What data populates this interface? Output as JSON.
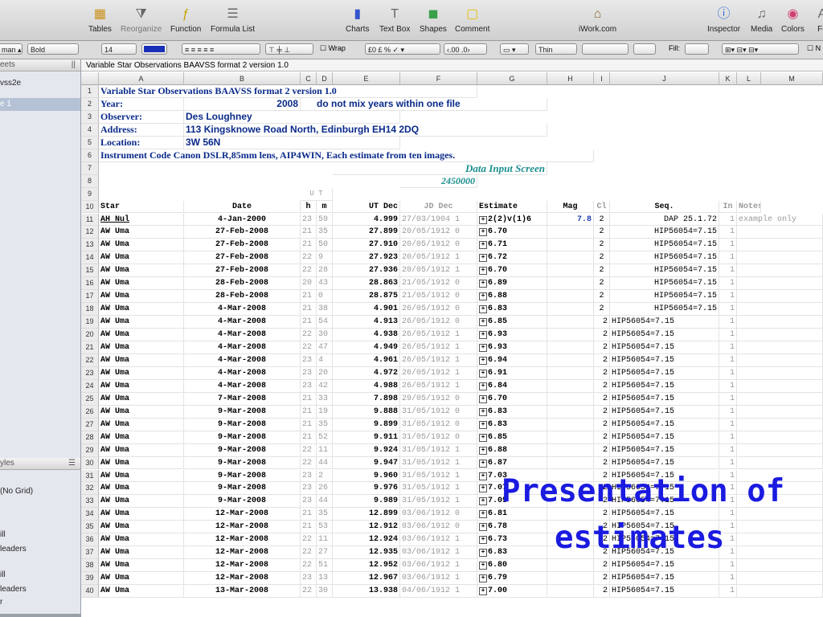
{
  "toolbar": {
    "items": [
      {
        "label": "Tables",
        "icon": "tables-icon"
      },
      {
        "label": "Reorganize",
        "icon": "reorganize-icon"
      },
      {
        "label": "Function",
        "icon": "function-icon"
      },
      {
        "label": "Formula List",
        "icon": "formula-list-icon"
      },
      {
        "label": "Charts",
        "icon": "charts-icon"
      },
      {
        "label": "Text Box",
        "icon": "text-box-icon"
      },
      {
        "label": "Shapes",
        "icon": "shapes-icon"
      },
      {
        "label": "Comment",
        "icon": "comment-icon"
      },
      {
        "label": "iWork.com",
        "icon": "iwork-icon"
      },
      {
        "label": "Inspector",
        "icon": "inspector-icon"
      },
      {
        "label": "Media",
        "icon": "media-icon"
      },
      {
        "label": "Colors",
        "icon": "colors-icon"
      },
      {
        "label": "Fo",
        "icon": "fonts-icon"
      }
    ]
  },
  "format_bar": {
    "font_name": "man",
    "font_style": "Bold",
    "font_size": "14",
    "text_color": "#1a2fb8",
    "wrap_label": "Wrap",
    "decimals": ".00",
    "line_style": "Thin",
    "fill_label": "Fill:",
    "grid_label": "N"
  },
  "sidebar": {
    "sheets_header": "eets",
    "sheet_name": "vss2e",
    "table_name": "e 1",
    "styles_header": "yles",
    "styles": [
      "(No Grid)",
      "ill",
      "leaders",
      "ill",
      "leaders",
      "r"
    ]
  },
  "table": {
    "title": "Variable Star Observations BAAVSS format 2 version 1.0",
    "columns": [
      "A",
      "B",
      "C",
      "D",
      "E",
      "F",
      "G",
      "H",
      "I",
      "J",
      "K",
      "L",
      "M"
    ],
    "header_block": {
      "r1": "Variable Star Observations BAAVSS format 2 version 1.0",
      "r2_label": "Year:",
      "r2_value": "2008",
      "r2_note": "do not mix years within one file",
      "r3_label": "Observer:",
      "r3_value": "Des Loughney",
      "r4_label": "Address:",
      "r4_value": "113 Kingsknowe Road North, Edinburgh EH14 2DQ",
      "r5_label": "Location:",
      "r5_value": "3W 56N",
      "r6": "Instrument Code Canon DSLR,85mm lens, AIP4WIN, Each estimate from ten images.",
      "r7": "Data Input Screen",
      "r8": "2450000",
      "r9_ut": "U T"
    },
    "headers": [
      "Star",
      "Date",
      "h",
      "m",
      "UT Dec",
      "JD Dec",
      "Estimate",
      "Mag",
      "Cl",
      "Seq.",
      "In",
      "Notes"
    ],
    "rows": [
      [
        "11",
        "AH Nul",
        "4-Jan-2000",
        "23",
        "59",
        "4.999",
        "27/03/1904 1",
        "2(2)v(1)6",
        "7.8",
        "2",
        "DAP 25.1.72",
        "1",
        "example only"
      ],
      [
        "12",
        "AW Uma",
        "27-Feb-2008",
        "21",
        "35",
        "27.899",
        "20/05/1912 0",
        "6.70",
        "",
        "2",
        "HIP56054=7.15",
        "1",
        ""
      ],
      [
        "13",
        "AW Uma",
        "27-Feb-2008",
        "21",
        "50",
        "27.910",
        "20/05/1912 0",
        "6.71",
        "",
        "2",
        "HIP56054=7.15",
        "1",
        ""
      ],
      [
        "14",
        "AW Uma",
        "27-Feb-2008",
        "22",
        "9",
        "27.923",
        "20/05/1912 1",
        "6.72",
        "",
        "2",
        "HIP56054=7.15",
        "1",
        ""
      ],
      [
        "15",
        "AW Uma",
        "27-Feb-2008",
        "22",
        "28",
        "27.936",
        "20/05/1912 1",
        "6.70",
        "",
        "2",
        "HIP56054=7.15",
        "1",
        ""
      ],
      [
        "16",
        "AW Uma",
        "28-Feb-2008",
        "20",
        "43",
        "28.863",
        "21/05/1912 0",
        "6.89",
        "",
        "2",
        "HIP56054=7.15",
        "1",
        ""
      ],
      [
        "17",
        "AW Uma",
        "28-Feb-2008",
        "21",
        "0",
        "28.875",
        "21/05/1912 0",
        "6.88",
        "",
        "2",
        "HIP56054=7.15",
        "1",
        ""
      ],
      [
        "18",
        "AW Uma",
        "4-Mar-2008",
        "21",
        "38",
        "4.901",
        "26/05/1912 0",
        "6.83",
        "",
        "2",
        "HIP56054=7.15",
        "1",
        ""
      ],
      [
        "19",
        "AW Uma",
        "4-Mar-2008",
        "21",
        "54",
        "4.913",
        "26/05/1912 0",
        "6.85",
        "",
        "2",
        "HIP56054=7.15",
        "1",
        ""
      ],
      [
        "20",
        "AW Uma",
        "4-Mar-2008",
        "22",
        "30",
        "4.938",
        "26/05/1912 1",
        "6.93",
        "",
        "2",
        "HIP56054=7.15",
        "1",
        ""
      ],
      [
        "21",
        "AW Uma",
        "4-Mar-2008",
        "22",
        "47",
        "4.949",
        "26/05/1912 1",
        "6.93",
        "",
        "2",
        "HIP56054=7.15",
        "1",
        ""
      ],
      [
        "22",
        "AW Uma",
        "4-Mar-2008",
        "23",
        "4",
        "4.961",
        "26/05/1912 1",
        "6.94",
        "",
        "2",
        "HIP56054=7.15",
        "1",
        ""
      ],
      [
        "23",
        "AW Uma",
        "4-Mar-2008",
        "23",
        "20",
        "4.972",
        "26/05/1912 1",
        "6.91",
        "",
        "2",
        "HIP56054=7.15",
        "1",
        ""
      ],
      [
        "24",
        "AW Uma",
        "4-Mar-2008",
        "23",
        "42",
        "4.988",
        "26/05/1912 1",
        "6.84",
        "",
        "2",
        "HIP56054=7.15",
        "1",
        ""
      ],
      [
        "25",
        "AW Uma",
        "7-Mar-2008",
        "21",
        "33",
        "7.898",
        "29/05/1912 0",
        "6.70",
        "",
        "2",
        "HIP56054=7.15",
        "1",
        ""
      ],
      [
        "26",
        "AW Uma",
        "9-Mar-2008",
        "21",
        "19",
        "9.888",
        "31/05/1912 0",
        "6.83",
        "",
        "2",
        "HIP56054=7.15",
        "1",
        ""
      ],
      [
        "27",
        "AW Uma",
        "9-Mar-2008",
        "21",
        "35",
        "9.899",
        "31/05/1912 0",
        "6.83",
        "",
        "2",
        "HIP56054=7.15",
        "1",
        ""
      ],
      [
        "28",
        "AW Uma",
        "9-Mar-2008",
        "21",
        "52",
        "9.911",
        "31/05/1912 0",
        "6.85",
        "",
        "2",
        "HIP56054=7.15",
        "1",
        ""
      ],
      [
        "29",
        "AW Uma",
        "9-Mar-2008",
        "22",
        "11",
        "9.924",
        "31/05/1912 1",
        "6.88",
        "",
        "2",
        "HIP56054=7.15",
        "1",
        ""
      ],
      [
        "30",
        "AW Uma",
        "9-Mar-2008",
        "22",
        "44",
        "9.947",
        "31/05/1912 1",
        "6.87",
        "",
        "2",
        "HIP56054=7.15",
        "1",
        ""
      ],
      [
        "31",
        "AW Uma",
        "9-Mar-2008",
        "23",
        "2",
        "9.960",
        "31/05/1912 1",
        "7.03",
        "",
        "2",
        "HIP56054=7.15",
        "1",
        ""
      ],
      [
        "32",
        "AW Uma",
        "9-Mar-2008",
        "23",
        "26",
        "9.976",
        "31/05/1912 1",
        "7.07",
        "",
        "2",
        "HIP56054=7.15",
        "1",
        ""
      ],
      [
        "33",
        "AW Uma",
        "9-Mar-2008",
        "23",
        "44",
        "9.989",
        "31/05/1912 1",
        "7.05",
        "",
        "2",
        "HIP56054=7.15",
        "1",
        ""
      ],
      [
        "34",
        "AW Uma",
        "12-Mar-2008",
        "21",
        "35",
        "12.899",
        "03/06/1912 0",
        "6.81",
        "",
        "2",
        "HIP56054=7.15",
        "1",
        ""
      ],
      [
        "35",
        "AW Uma",
        "12-Mar-2008",
        "21",
        "53",
        "12.912",
        "03/06/1912 0",
        "6.78",
        "",
        "2",
        "HIP56054=7.15",
        "1",
        ""
      ],
      [
        "36",
        "AW Uma",
        "12-Mar-2008",
        "22",
        "11",
        "12.924",
        "03/06/1912 1",
        "6.73",
        "",
        "2",
        "HIP56054=7.15",
        "1",
        ""
      ],
      [
        "37",
        "AW Uma",
        "12-Mar-2008",
        "22",
        "27",
        "12.935",
        "03/06/1912 1",
        "6.83",
        "",
        "2",
        "HIP56054=7.15",
        "1",
        ""
      ],
      [
        "38",
        "AW Uma",
        "12-Mar-2008",
        "22",
        "51",
        "12.952",
        "03/06/1912 1",
        "6.80",
        "",
        "2",
        "HIP56054=7.15",
        "1",
        ""
      ],
      [
        "39",
        "AW Uma",
        "12-Mar-2008",
        "23",
        "13",
        "12.967",
        "03/06/1912 1",
        "6.79",
        "",
        "2",
        "HIP56054=7.15",
        "1",
        ""
      ],
      [
        "40",
        "AW Uma",
        "13-Mar-2008",
        "22",
        "30",
        "13.938",
        "04/06/1912 1",
        "7.00",
        "",
        "2",
        "HIP56054=7.15",
        "1",
        ""
      ]
    ]
  },
  "overlay": {
    "line1": "Presentation of",
    "line2": "estimates"
  }
}
